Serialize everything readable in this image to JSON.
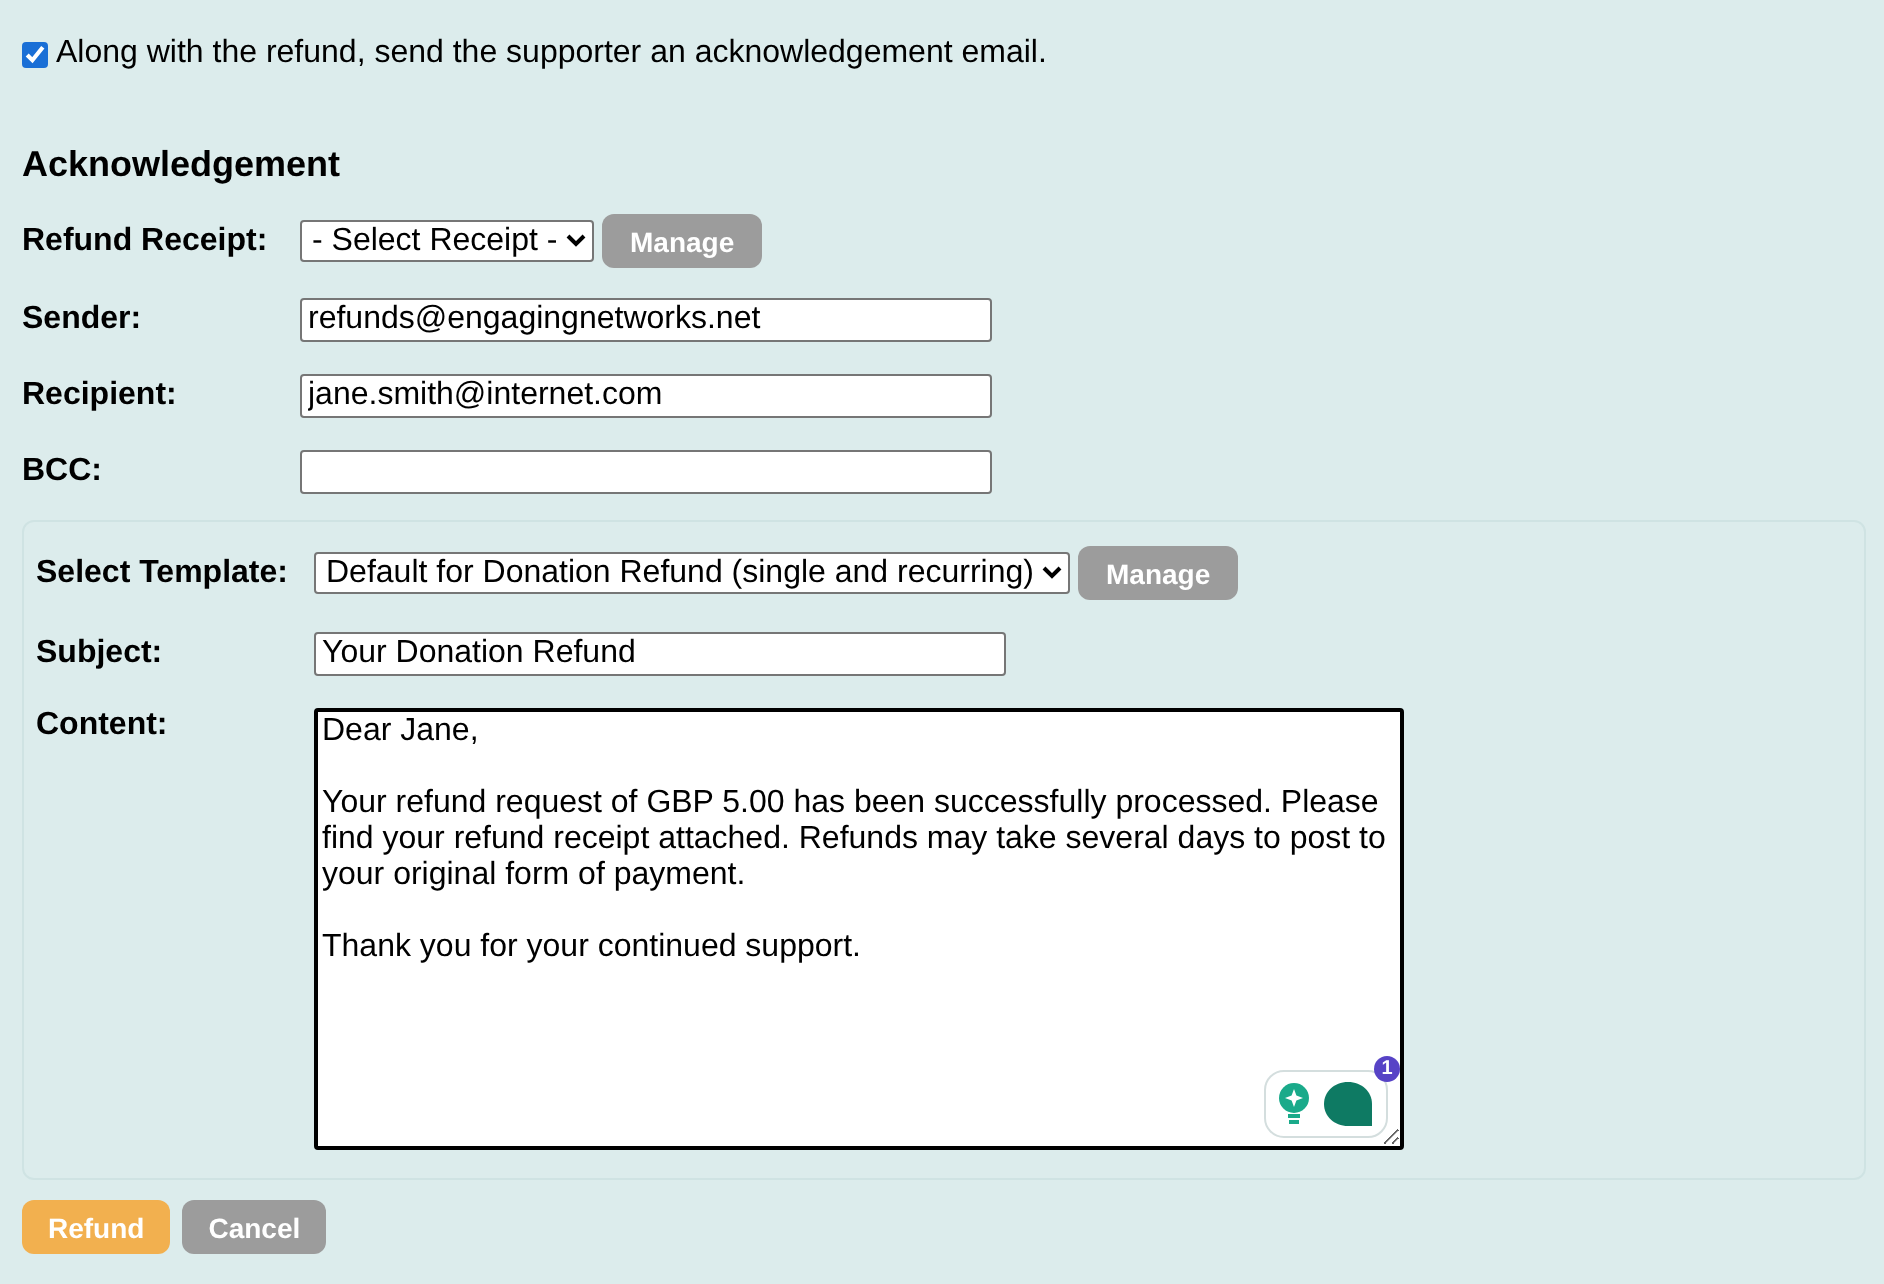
{
  "acknowledge": {
    "checked": true,
    "label": "Along with the refund, send the supporter an acknowledgement email."
  },
  "heading": "Acknowledgement",
  "fields": [
    {
      "kind": "select",
      "label": "Refund Receipt:",
      "value": "- Select Receipt -",
      "button": "Manage"
    },
    {
      "kind": "text",
      "label": "Sender:",
      "value": "refunds@engagingnetworks.net"
    },
    {
      "kind": "text",
      "label": "Recipient:",
      "value": "jane.smith@internet.com"
    },
    {
      "kind": "text",
      "label": "BCC:"
    }
  ],
  "template": {
    "fields": [
      {
        "kind": "select",
        "label": "Select Template:",
        "value": "Default for Donation Refund (single and recurring)",
        "button": "Manage"
      },
      {
        "kind": "text",
        "label": "Subject:",
        "value": "Your Donation Refund"
      },
      {
        "kind": "textarea",
        "label": "Content:",
        "value": "Dear Jane,\n\nYour refund request of GBP 5.00 has been successfully processed. Please find your refund receipt attached. Refunds may take several days to post to your original form of payment.\n\nThank you for your continued support."
      }
    ],
    "assistant_badge": "1"
  },
  "buttons": [
    {
      "label": "Refund",
      "kind": "primary"
    },
    {
      "label": "Cancel",
      "kind": "secondary"
    }
  ]
}
